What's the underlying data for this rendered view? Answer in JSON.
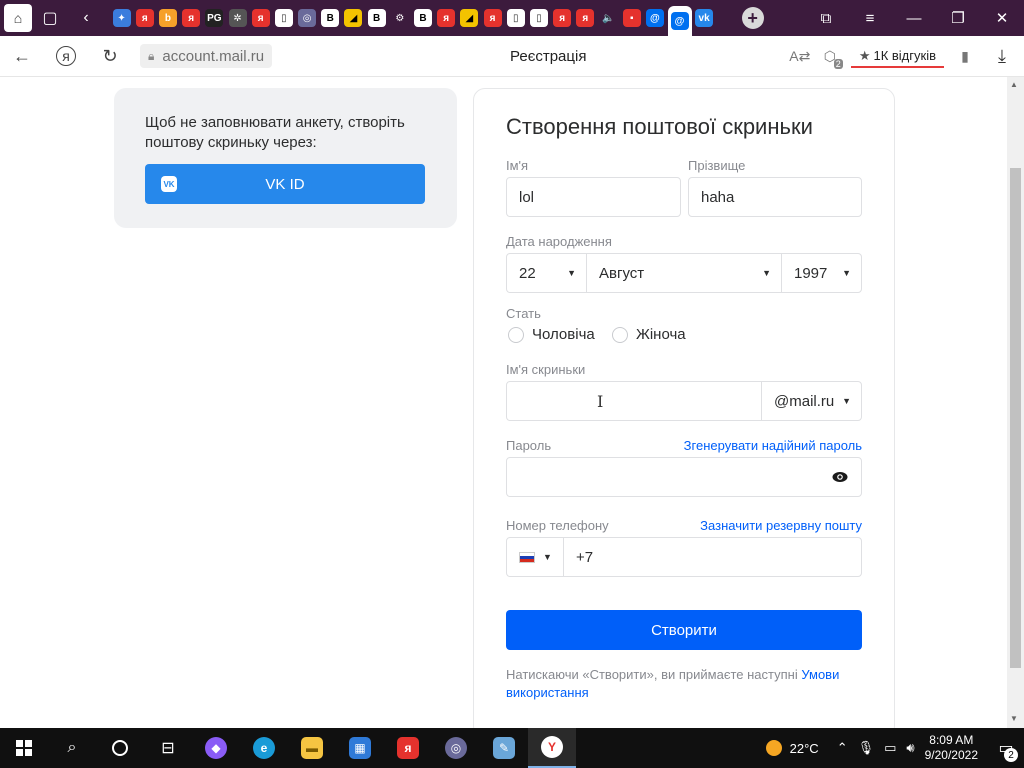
{
  "browser": {
    "url": "account.mail.ru",
    "page_title": "Реєстрація",
    "reviews_label": "1К відгуків",
    "translate_badge": "2",
    "tab_icons": [
      "я",
      "я",
      "PG",
      "я",
      "В",
      "В",
      "В",
      "я",
      "я",
      "я",
      "я"
    ]
  },
  "vk_card": {
    "text": "Щоб не заповнювати анкету, створіть поштову скриньку через:",
    "button_label": "VK ID",
    "logo_text": "VK"
  },
  "form": {
    "title": "Створення поштової скриньки",
    "first_name": {
      "label": "Ім'я",
      "value": "lol"
    },
    "last_name": {
      "label": "Прізвище",
      "value": "haha"
    },
    "birth_date": {
      "label": "Дата народження",
      "day": "22",
      "month": "Август",
      "year": "1997"
    },
    "gender": {
      "label": "Стать",
      "male": "Чоловіча",
      "female": "Жіноча"
    },
    "mailbox": {
      "label": "Ім'я скриньки",
      "value": "",
      "domain": "@mail.ru"
    },
    "password": {
      "label": "Пароль",
      "generate_link": "Згенерувати надійний пароль",
      "value": ""
    },
    "phone": {
      "label": "Номер телефону",
      "backup_link": "Зазначити резервну пошту",
      "prefix": "+7"
    },
    "submit_label": "Створити",
    "terms_text": "Натискаючи «Створити», ви приймаєте наступні ",
    "terms_link": "Умови використання"
  },
  "taskbar": {
    "weather": "22°C",
    "time": "8:09 AM",
    "date": "9/20/2022",
    "notifications": "2"
  },
  "colors": {
    "tab_strip": "#3c1b3d",
    "vk_blue": "#2688eb",
    "mail_blue": "#005ff9"
  }
}
